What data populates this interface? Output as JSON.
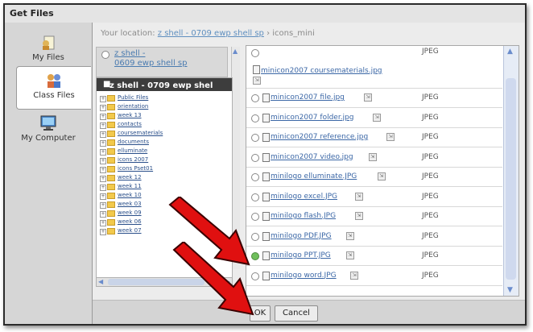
{
  "window": {
    "title": "Get Files"
  },
  "nav": [
    {
      "label": "My Files",
      "icon": "user-doc-icon"
    },
    {
      "label": "Class Files",
      "icon": "group-people-icon"
    },
    {
      "label": "My Computer",
      "icon": "computer-icon"
    }
  ],
  "location": {
    "prefix": "Your location:",
    "link": "z shell - 0709 ewp shell sp",
    "separator": "›",
    "current": "icons_mini"
  },
  "parent_folder": {
    "line1": "z shell -",
    "line2": "0609 ewp shell sp"
  },
  "tree": {
    "header": "z shell - 0709 ewp shel",
    "items": [
      "Public Files",
      "orientation",
      "week 13",
      "contacts",
      "coursematerials",
      "documents",
      "elluminate",
      "icons 2007",
      "icons Pset01",
      "week 12",
      "week 11",
      "week 10",
      "week 03",
      "week 09",
      "week 06",
      "week 07"
    ]
  },
  "files": [
    {
      "name": "minicon2007 coursematerials.jpg",
      "type": "JPEG",
      "checked": false
    },
    {
      "name": "minicon2007 file.jpg",
      "type": "JPEG",
      "checked": false
    },
    {
      "name": "minicon2007 folder.jpg",
      "type": "JPEG",
      "checked": false
    },
    {
      "name": "minicon2007 reference.jpg",
      "type": "JPEG",
      "checked": false
    },
    {
      "name": "minicon2007 video.jpg",
      "type": "JPEG",
      "checked": false
    },
    {
      "name": "minilogo elluminate.JPG",
      "type": "JPEG",
      "checked": false
    },
    {
      "name": "minilogo excel.JPG",
      "type": "JPEG",
      "checked": false
    },
    {
      "name": "minilogo flash.JPG",
      "type": "JPEG",
      "checked": false
    },
    {
      "name": "minilogo PDF.JPG",
      "type": "JPEG",
      "checked": false
    },
    {
      "name": "minilogo PPT.JPG",
      "type": "JPEG",
      "checked": true
    },
    {
      "name": "minilogo word.JPG",
      "type": "JPEG",
      "checked": false
    }
  ],
  "buttons": {
    "ok": "OK",
    "cancel": "Cancel"
  },
  "colors": {
    "arrow": "#e01010",
    "header_bg": "#3d3d3d",
    "link": "#3b67a6"
  }
}
